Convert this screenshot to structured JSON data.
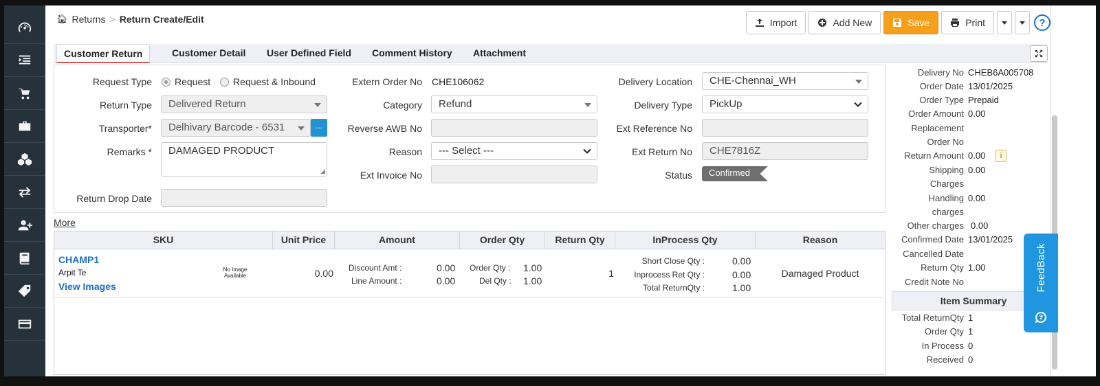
{
  "breadcrumb": {
    "home": "Returns",
    "separator": ">",
    "current": "Return Create/Edit"
  },
  "toolbar": {
    "import": "Import",
    "add_new": "Add New",
    "save": "Save",
    "print": "Print",
    "help": "?"
  },
  "tabs": [
    {
      "label": "Customer Return",
      "active": true
    },
    {
      "label": "Customer Detail"
    },
    {
      "label": "User Defined Field"
    },
    {
      "label": "Comment History"
    },
    {
      "label": "Attachment"
    }
  ],
  "form": {
    "request_type_label": "Request Type",
    "request_option": "Request",
    "request_inbound_option": "Request & Inbound",
    "return_type_label": "Return Type",
    "return_type_value": "Delivered Return",
    "transporter_label": "Transporter*",
    "transporter_value": "Delhivary Barcode - 6531",
    "transporter_btn": "...",
    "remarks_label": "Remarks *",
    "remarks_value": "DAMAGED PRODUCT",
    "return_drop_date_label": "Return Drop Date",
    "extern_order_label": "Extern Order No",
    "extern_order_value": "CHE106062",
    "category_label": "Category",
    "category_value": "Refund",
    "reverse_awb_label": "Reverse AWB No",
    "reason_label": "Reason",
    "reason_value": "--- Select ---",
    "ext_invoice_label": "Ext Invoice No",
    "delivery_location_label": "Delivery Location",
    "delivery_location_value": "CHE-Chennai_WH",
    "delivery_type_label": "Delivery Type",
    "delivery_type_value": "PickUp",
    "ext_reference_label": "Ext Reference No",
    "ext_return_label": "Ext Return No",
    "ext_return_value": "CHE7816Z",
    "status_label": "Status",
    "status_value": "Confirmed"
  },
  "more_link": "More",
  "table": {
    "headers": [
      "SKU",
      "Unit Price",
      "Amount",
      "Order Qty",
      "Return Qty",
      "InProcess Qty",
      "Reason"
    ],
    "row": {
      "sku": "CHAMP1",
      "desc": "Arpit Te",
      "view_images": "View Images",
      "no_image_1": "No Image",
      "no_image_2": "Available",
      "unit_price": "0.00",
      "discount_label": "Discount Amt :",
      "discount_value": "0.00",
      "line_amount_label": "Line Amount :",
      "line_amount_value": "0.00",
      "order_qty_label": "Order Qty :",
      "order_qty_value": "1.00",
      "del_qty_label": "Del Qty :",
      "del_qty_value": "1.00",
      "return_qty": "1",
      "short_close_label": "Short Close Qty :",
      "short_close_value": "0.00",
      "inprocess_ret_label": "Inprocess Ret Qty :",
      "inprocess_ret_value": "0.00",
      "total_return_label": "Total ReturnQty :",
      "total_return_value": "1.00",
      "reason": "Damaged Product"
    }
  },
  "right_panel": {
    "delivery_no_label": "Delivery No",
    "delivery_no_value": "CHEB6A005708",
    "order_date_label": "Order Date",
    "order_date_value": "13/01/2025",
    "order_type_label": "Order Type",
    "order_type_value": "Prepaid",
    "order_amount_label": "Order Amount",
    "order_amount_value": "0.00",
    "replacement_label_1": "Replacement",
    "replacement_label_2": "Order No",
    "return_amount_label": "Return Amount",
    "return_amount_value": "0.00",
    "shipping_label_1": "Shipping",
    "shipping_label_2": "Charges",
    "shipping_value": "0.00",
    "handling_label_1": "Handling",
    "handling_label_2": "charges",
    "handling_value": "0.00",
    "other_charges_label": "Other charges",
    "other_charges_value": "0.00",
    "confirmed_date_label": "Confirmed Date",
    "confirmed_date_value": "13/01/2025",
    "cancelled_date_label": "Cancelled Date",
    "return_qty_label": "Return Qty",
    "return_qty_value": "1.00",
    "credit_note_label": "Credit Note No",
    "item_summary_title": "Item Summary",
    "total_return_qty_label": "Total ReturnQty",
    "total_return_qty_value": "1",
    "order_qty_label": "Order Qty",
    "order_qty_value": "1",
    "in_process_label": "In Process",
    "in_process_value": "0",
    "received_label": "Received",
    "received_value": "0"
  },
  "feedback": "FeedBack",
  "colors": {
    "save": "#f59f1b",
    "sidebar": "#26323a",
    "link": "#1a6fc4",
    "feedback": "#2196e0",
    "accent_tab": "#d9534f"
  },
  "sidebar_icons": [
    "dashboard-icon",
    "inbound-list-icon",
    "cart-icon",
    "briefcase-icon",
    "boxes-icon",
    "transfer-icon",
    "add-user-icon",
    "book-icon",
    "tag-icon",
    "card-icon"
  ]
}
